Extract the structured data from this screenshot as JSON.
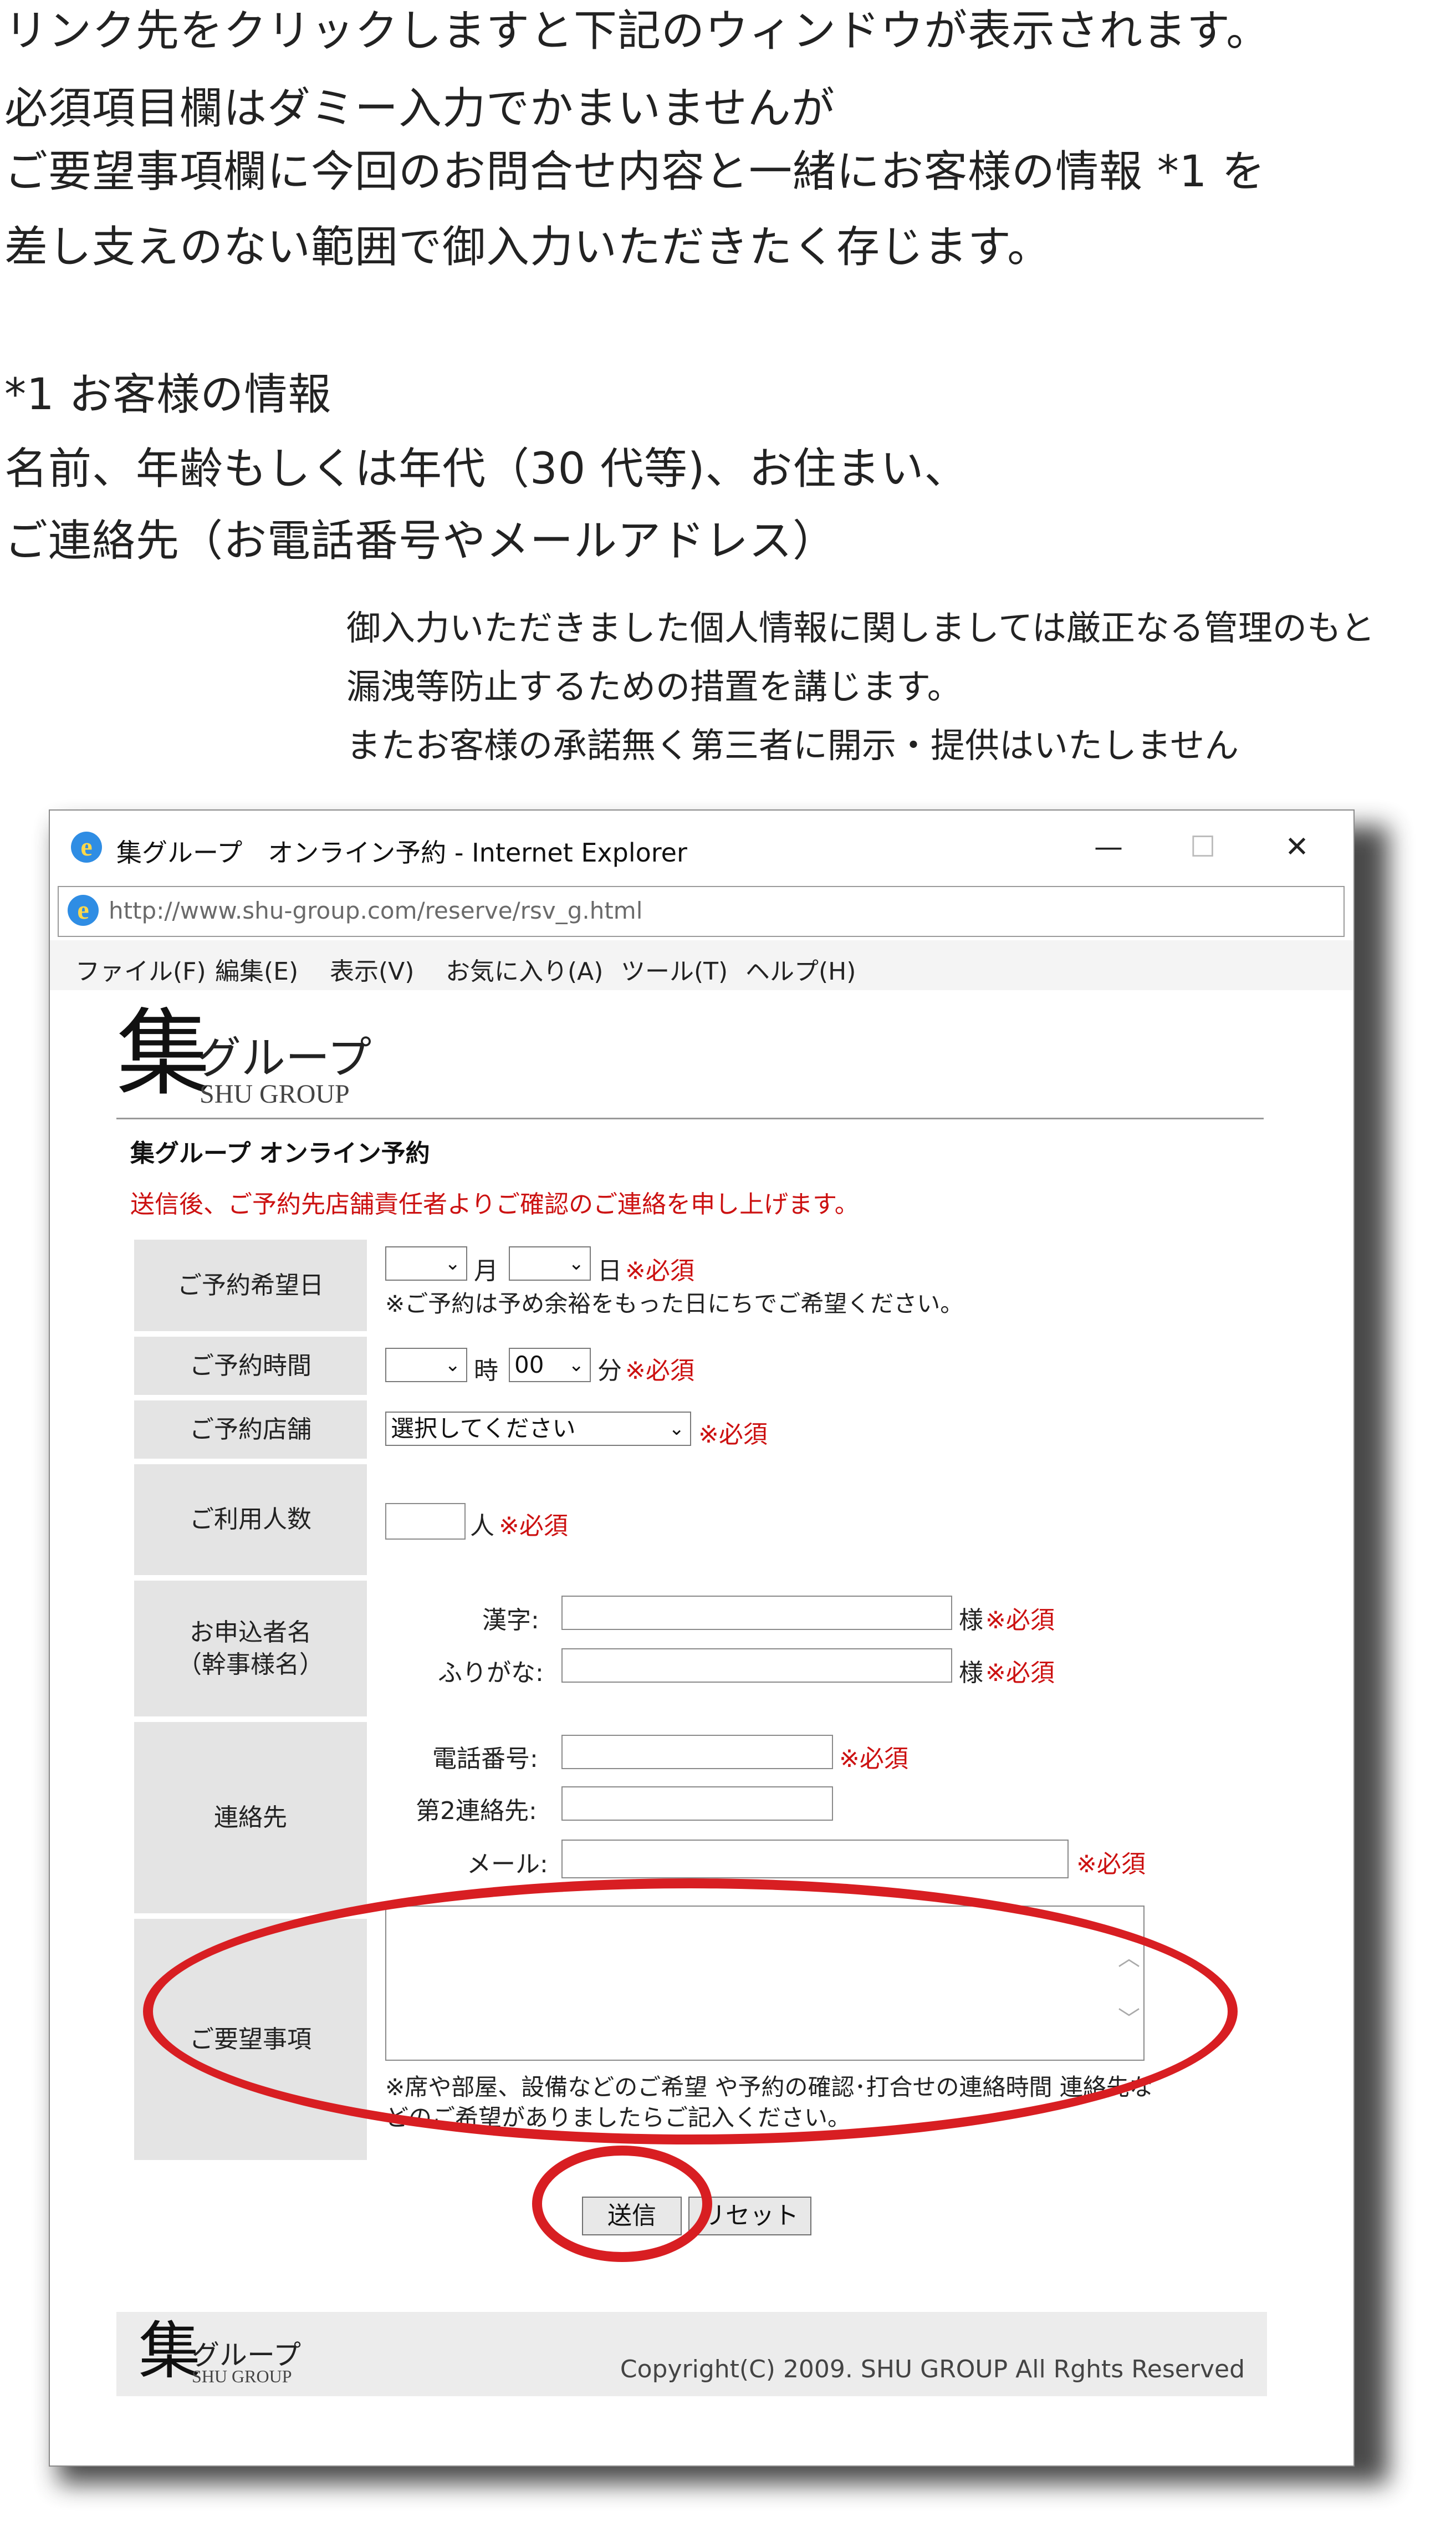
{
  "intro": {
    "line1": "リンク先をクリックしますと下記のウィンドウが表示されます。",
    "line2": "必須項目欄はダミー入力でかまいませんが",
    "line3": "ご要望事項欄に今回のお問合せ内容と一緒にお客様の情報 *1 を",
    "line4": "差し支えのない範囲で御入力いただきたく存じます。",
    "fn_title": "*1 お客様の情報",
    "fn_line1": "名前、年齢もしくは年代（30 代等)、お住まい、",
    "fn_line2": "ご連絡先（お電話番号やメールアドレス）"
  },
  "privacy": {
    "line1": "御入力いただきました個人情報に関しましては厳正なる管理のもと",
    "line2": "漏洩等防止するための措置を講じます。",
    "line3": "またお客様の承諾無く第三者に開示・提供はいたしません"
  },
  "window": {
    "title": "集グループ　オンライン予約 - Internet Explorer",
    "minimize": "—",
    "maximize": "☐",
    "close": "✕",
    "url": "http://www.shu-group.com/reserve/rsv_g.html",
    "menu": [
      "ファイル(F)",
      "編集(E)",
      "表示(V)",
      "お気に入り(A)",
      "ツール(T)",
      "ヘルプ(H)"
    ]
  },
  "page": {
    "logo_kanji": "集",
    "logo_kana": "グループ",
    "logo_en": "SHU GROUP",
    "title": "集グループ オンライン予約",
    "notice": "送信後、ご予約先店舗責任者よりご確認のご連絡を申し上げます。",
    "required": "※必須",
    "date": {
      "label": "ご予約希望日",
      "month_unit": "月",
      "day_unit": "日",
      "hint": "※ご予約は予め余裕をもった日にちでご希望ください。"
    },
    "time": {
      "label": "ご予約時間",
      "hour_unit": "時",
      "minute_value": "00",
      "minute_unit": "分"
    },
    "store": {
      "label": "ご予約店舗",
      "value": "選択してください"
    },
    "people": {
      "label": "ご利用人数",
      "unit": "人"
    },
    "applicant": {
      "label_l1": "お申込者名",
      "label_l2": "（幹事様名）",
      "kanji_label": "漢字:",
      "kana_label": "ふりがな:",
      "suffix": "様"
    },
    "contact": {
      "label": "連絡先",
      "phone_label": "電話番号:",
      "phone2_label": "第2連絡先:",
      "mail_label": "メール:"
    },
    "requests": {
      "label": "ご要望事項",
      "hint_l1": "※席や部屋、設備などのご希望 や予約の確認･打合せの連絡時間 連絡先な",
      "hint_l2": "どのご希望がありましたらご記入ください。"
    },
    "submit": "送信",
    "reset": "リセット",
    "copyright": "Copyright(C) 2009. SHU GROUP All Rghts Reserved"
  }
}
